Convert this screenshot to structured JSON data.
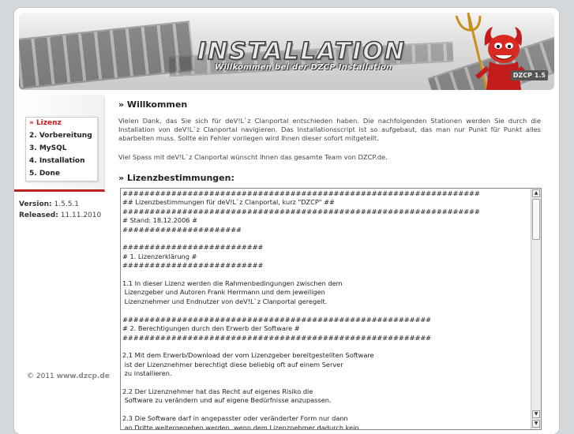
{
  "header": {
    "title": "INSTALLATION",
    "subtitle": "Willkommen bei der DZCP Installation",
    "badge": "DZCP 1.5"
  },
  "nav": {
    "items": [
      {
        "label": "» Lizenz"
      },
      {
        "label": "2. Vorbereitung"
      },
      {
        "label": "3. MySQL"
      },
      {
        "label": "4. Installation"
      },
      {
        "label": "5. Done"
      }
    ]
  },
  "info": {
    "version_label": "Version:",
    "version_value": "1.5.5.1",
    "released_label": "Released:",
    "released_value": "11.11.2010"
  },
  "footer": {
    "copyright": "© 2011",
    "site": "www.dzcp.de"
  },
  "main": {
    "welcome_heading": "» Willkommen",
    "welcome_text": "Vielen Dank, das Sie sich für deV!L`z Clanportal entschieden haben. Die nachfolgenden Stationen werden Sie durch die Installation von deV!L`z Clanportal navigieren. Das Installationsscript ist so aufgebaut, das man nur Punkt für Punkt alles abarbeiten muss. Sollte ein Fehler vorliegen wird Ihnen dieser sofort mitgeteilt.",
    "welcome_text2": "Viel Spass mit deV!L`z Clanportal wünscht Ihnen das gesamte Team von DZCP.de.",
    "license_heading": "» Lizenzbestimmungen:",
    "license_text": "##################################################################\n## Lizenzbestimmungen für deV!L`z Clanportal, kurz \"DZCP\" ##\n##################################################################\n# Stand: 18.12.2006 #\n######################\n\n##########################\n# 1. Lizenzerklärung #\n##########################\n\n1.1 In dieser Lizenz werden die Rahmenbedingungen zwischen dem\n Lizenzgeber und Autoren Frank Herrmann und dem jeweiligen\n Lizenznehmer und Endnutzer von deV!L`z Clanportal geregelt.\n\n#########################################################\n# 2. Berechtigungen durch den Erwerb der Software #\n#########################################################\n\n2.1 Mit dem Erwerb/Download der vom Lizenzgeber bereitgestellten Software\n ist der Lizenznehmer berechtigt diese beliebig oft auf einem Server\n zu installieren.\n\n2.2 Der Lizenznehmer hat das Recht auf eigenes Risiko die\n Software zu verändern und auf eigene Bedürfnisse anzupassen.\n\n2.3 Die Software darf in angepasster oder veränderter Form nur dann\n an Dritte weitergegeben werden, wenn dem Lizenznehmer dadurch kein"
  }
}
